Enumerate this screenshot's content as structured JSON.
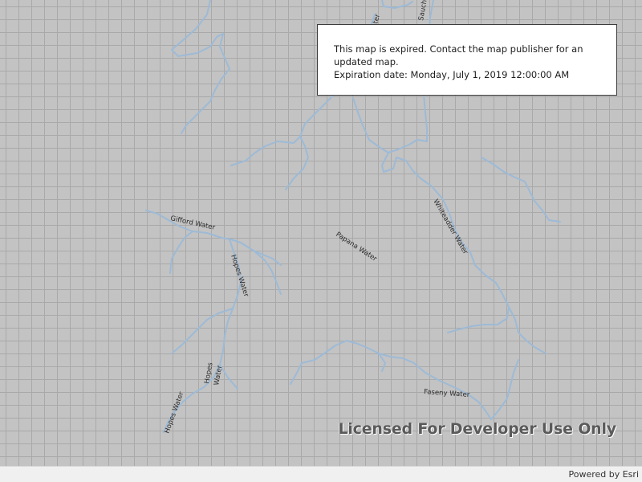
{
  "map": {
    "river_labels": {
      "gifford_water": "Gifford Water",
      "hopes_water_upper": "Hopes Water",
      "hopes_water_middle_line1": "Hopes",
      "hopes_water_middle_line2": "Water",
      "hopes_water_lower": "Hopes Water",
      "papana_water": "Papana Water",
      "whiteadder_water": "Whiteadder Water",
      "faseny_water": "Faseny Water",
      "sauchet_partial": "Sauche",
      "water_partial_top": "ter"
    },
    "colors": {
      "background": "#c3c3c3",
      "grid_line": "#a9a9a9",
      "river": "#9dbad6"
    }
  },
  "expired_notice": {
    "message": "This map is expired. Contact the map publisher for an updated map.",
    "expiration": "Expiration date: Monday, July 1, 2019 12:00:00 AM"
  },
  "watermark": "Licensed For Developer Use Only",
  "attribution": "Powered by Esri"
}
